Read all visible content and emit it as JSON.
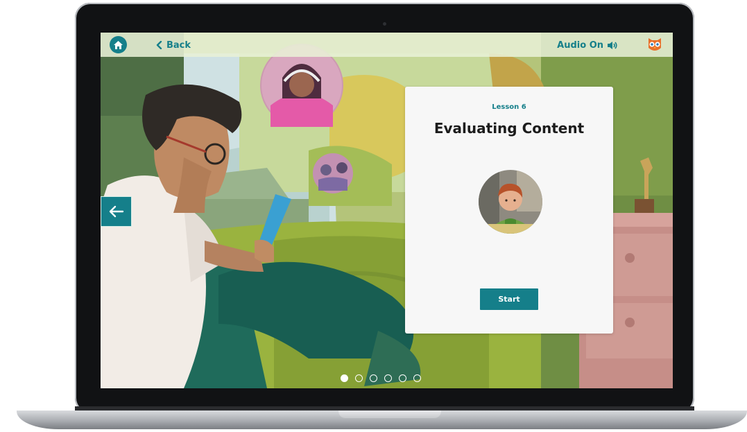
{
  "nav": {
    "back_label": "Back",
    "audio_label": "Audio On",
    "home_icon": "home-icon",
    "audio_icon": "speaker-icon",
    "avatar_icon": "owl-avatar-icon"
  },
  "lesson": {
    "number_label": "Lesson 6",
    "title": "Evaluating Content",
    "start_label": "Start"
  },
  "pagination": {
    "total": 6,
    "active_index": 0
  },
  "colors": {
    "accent": "#157f8a",
    "topbar": "#e8f0d6",
    "card": "#f7f7f7"
  }
}
